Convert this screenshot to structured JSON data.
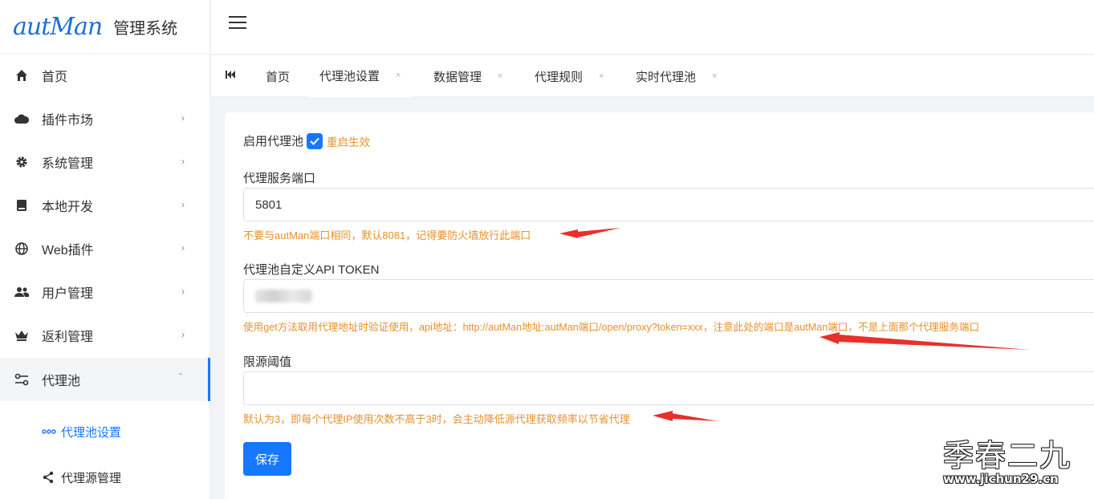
{
  "brand": {
    "logo_text": "autMan",
    "title": "管理系统"
  },
  "sidebar": {
    "items": [
      {
        "label": "首页",
        "icon": "home-icon"
      },
      {
        "label": "插件市场",
        "icon": "cloud-icon"
      },
      {
        "label": "系统管理",
        "icon": "gear-icon"
      },
      {
        "label": "本地开发",
        "icon": "book-icon"
      },
      {
        "label": "Web插件",
        "icon": "globe-icon"
      },
      {
        "label": "用户管理",
        "icon": "users-icon"
      },
      {
        "label": "返利管理",
        "icon": "crown-icon"
      },
      {
        "label": "代理池",
        "icon": "proxy-icon"
      }
    ],
    "sub_items": [
      {
        "label": "代理池设置",
        "icon": "dots-icon"
      },
      {
        "label": "代理源管理",
        "icon": "share-icon"
      }
    ]
  },
  "tabs": [
    {
      "label": "首页"
    },
    {
      "label": "代理池设置"
    },
    {
      "label": "数据管理"
    },
    {
      "label": "代理规则"
    },
    {
      "label": "实时代理池"
    }
  ],
  "tab_close": "×",
  "form": {
    "enable_label": "启用代理池",
    "enable_checked": true,
    "enable_note": "重启生效",
    "port_label": "代理服务端口",
    "port_value": "5801",
    "port_hint": "不要与autMan端口相同，默认8081，记得要防火墙放行此端口",
    "token_label": "代理池自定义API TOKEN",
    "token_hint": "使用get方法取用代理地址时验证使用，api地址：http://autMan地址:autMan端口/open/proxy?token=xxx，注意此处的端口是autMan端口，不是上面那个代理服务端口",
    "threshold_label": "限源阈值",
    "threshold_value": "",
    "threshold_hint": "默认为3，即每个代理IP使用次数不高于3时，会主动降低源代理获取频率以节省代理",
    "save_label": "保存"
  },
  "watermark": {
    "text": "季春二九",
    "url": "www.jichun29.cn"
  },
  "colors": {
    "accent": "#1677ff",
    "warning": "#e6912d",
    "arrow": "#e8302a"
  }
}
